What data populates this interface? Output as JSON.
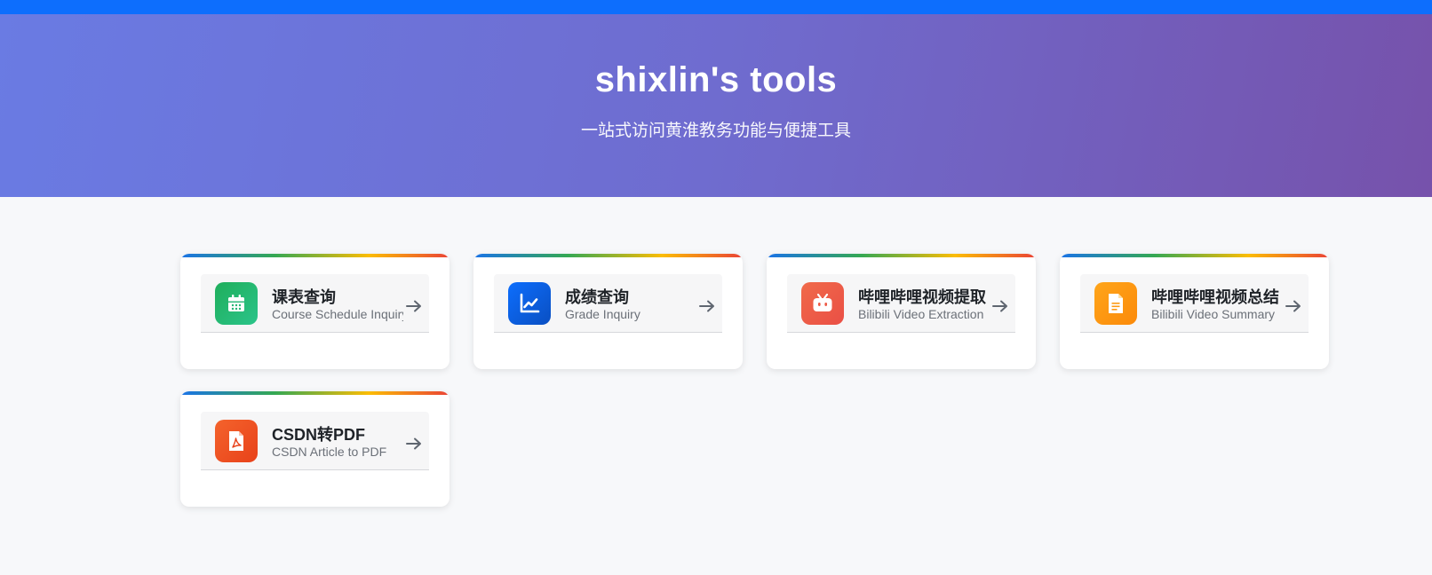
{
  "header": {
    "title": "shixlin's tools",
    "subtitle": "一站式访问黄淮教务功能与便捷工具"
  },
  "colors": {
    "topbar": "#0d6efd",
    "hero_start": "#6a7be3",
    "hero_end": "#7652ab",
    "background": "#f7f8fa"
  },
  "tools": [
    {
      "title": "课表查询",
      "subtitle": "Course Schedule Inquiry",
      "icon": "calendar-icon",
      "color": "#22b573"
    },
    {
      "title": "成绩查询",
      "subtitle": "Grade Inquiry",
      "icon": "chart-line-icon",
      "color": "#0d6efd"
    },
    {
      "title": "哔哩哔哩视频提取",
      "subtitle": "Bilibili Video Extraction",
      "icon": "bilibili-icon",
      "color": "#f0584a"
    },
    {
      "title": "哔哩哔哩视频总结",
      "subtitle": "Bilibili Video Summary",
      "icon": "document-icon",
      "color": "#fd9a13"
    },
    {
      "title": "CSDN转PDF",
      "subtitle": "CSDN Article to PDF",
      "icon": "pdf-icon",
      "color": "#f0511f"
    }
  ]
}
